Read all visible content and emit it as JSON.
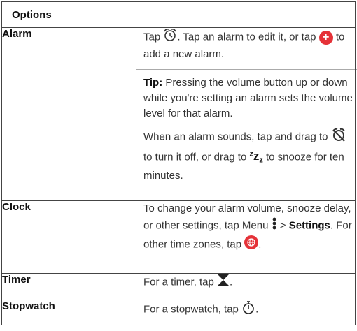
{
  "header": {
    "col1": "Options",
    "col2": ""
  },
  "rows": {
    "alarm": {
      "label": "Alarm",
      "p1_a": "Tap ",
      "p1_b": ". Tap an alarm to edit it, or tap ",
      "p1_c": " to add a new alarm.",
      "tip_label": "Tip:",
      "tip_text": " Pressing the volume button up or down while you're setting an alarm sets the volume level for that alarm.",
      "p3_a": "When an alarm sounds, tap  and drag to ",
      "p3_b": " to turn it off, or drag to ",
      "p3_c": " to snooze for ten minutes."
    },
    "clock": {
      "label": "Clock",
      "text_a": "To change your alarm volume, snooze delay, or other settings, tap Menu ",
      "text_b": " > ",
      "settings": "Settings",
      "text_c": ". For other time zones, tap ",
      "text_d": "."
    },
    "timer": {
      "label": "Timer",
      "text_a": "For a timer, tap ",
      "text_b": "."
    },
    "stopwatch": {
      "label": "Stopwatch",
      "text_a": "For a stopwatch, tap ",
      "text_b": "."
    }
  },
  "icons": {
    "alarm": "alarm-clock-icon",
    "add": "add-plus-icon",
    "alarm_off": "alarm-off-icon",
    "snooze": "snooze-zzz-icon",
    "menu": "menu-dots-icon",
    "globe": "globe-icon",
    "hourglass": "hourglass-icon",
    "stopwatch": "stopwatch-icon"
  },
  "colors": {
    "accent_red": "#e53238"
  }
}
